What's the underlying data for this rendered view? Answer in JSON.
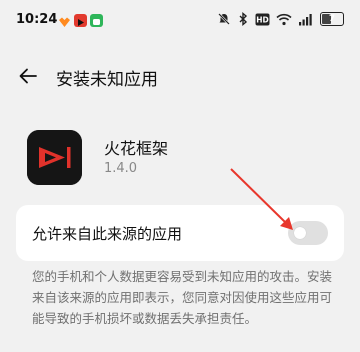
{
  "status_bar": {
    "time": "10:24",
    "battery": "7",
    "icons": [
      "mute-icon",
      "bluetooth-icon",
      "hd-icon",
      "wifi-icon",
      "signal-icon"
    ]
  },
  "header": {
    "title": "安装未知应用"
  },
  "app": {
    "name": "火花框架",
    "version": "1.4.0"
  },
  "setting": {
    "label": "允许来自此来源的应用",
    "enabled": false
  },
  "warning": "您的手机和个人数据更容易受到未知应用的攻击。安装来自该来源的应用即表示，您同意对因使用这些应用可能导致的手机损坏或数据丢失承担责任。",
  "colors": {
    "background": "#f1f1f1",
    "card": "#ffffff",
    "annotation_arrow": "#e8372c",
    "app_icon_red": "#e0322b"
  }
}
